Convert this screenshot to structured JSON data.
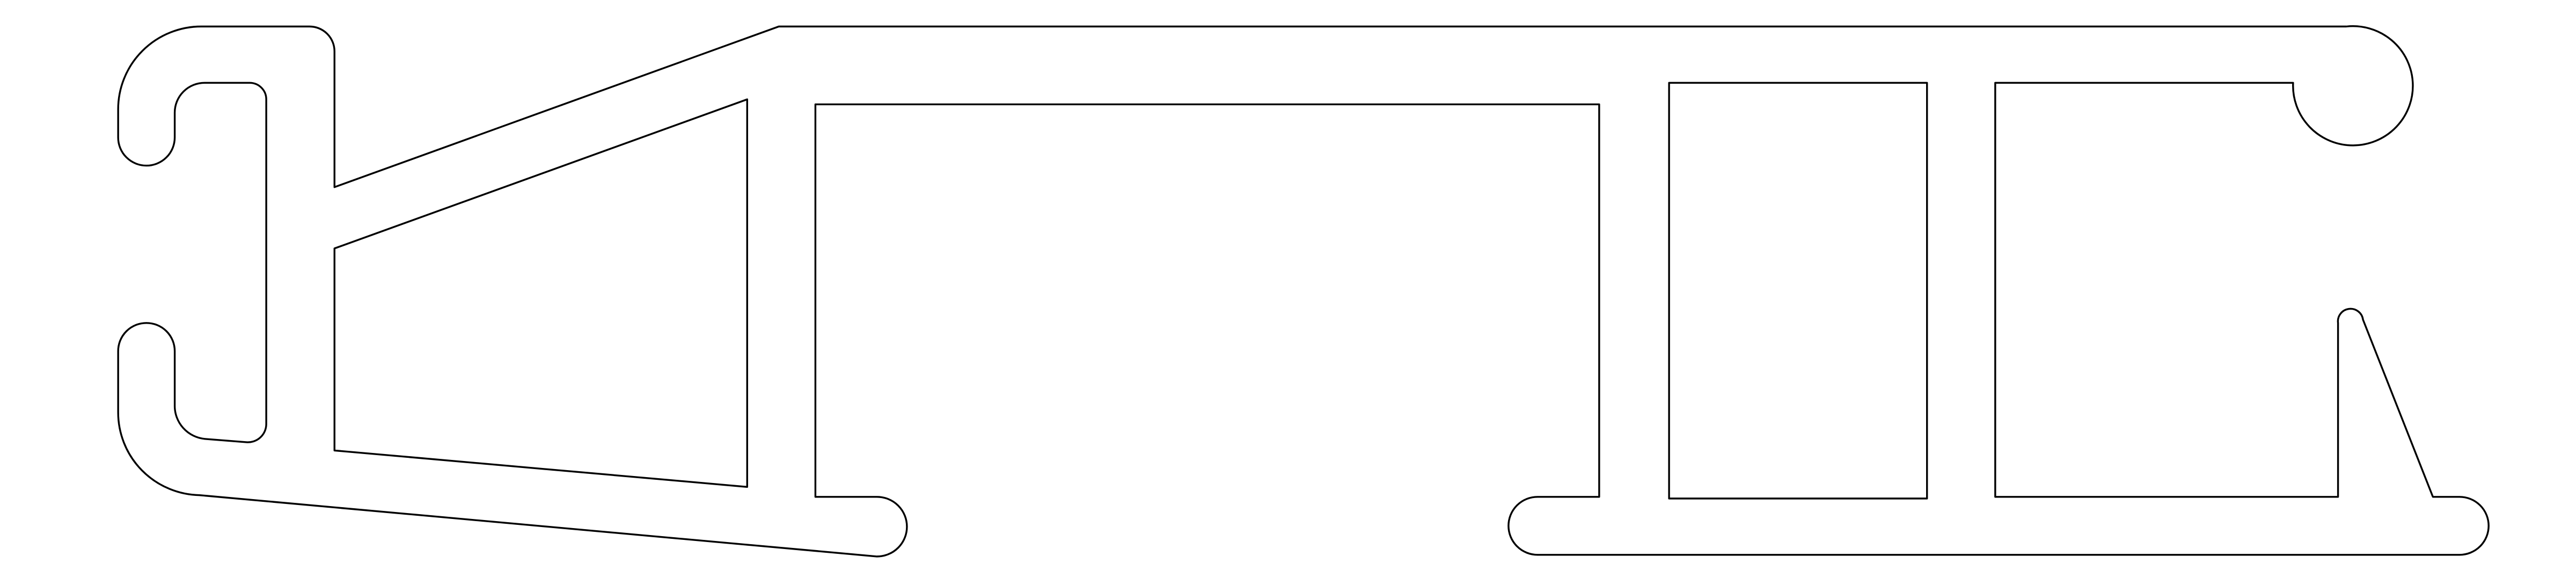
{
  "drawing": {
    "background_color": "#ffffff",
    "line_color": "#000000"
  }
}
